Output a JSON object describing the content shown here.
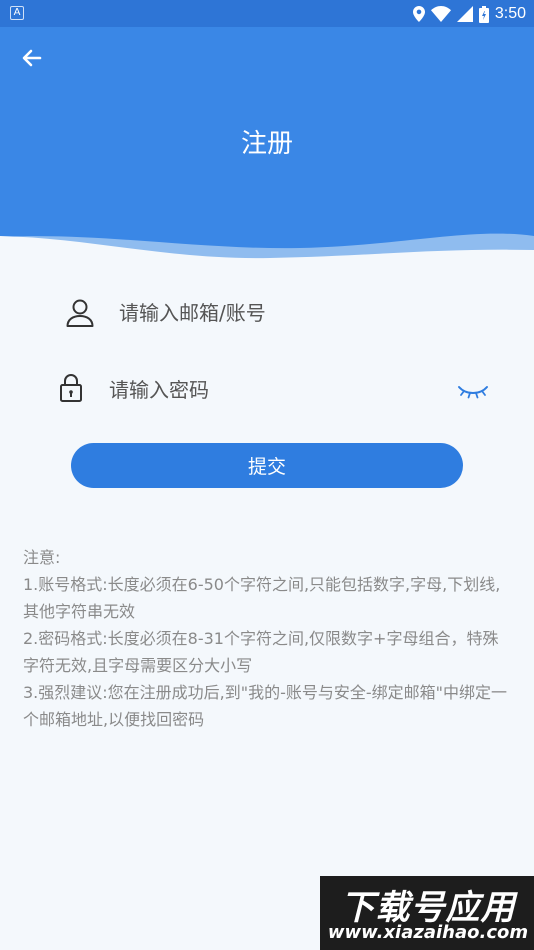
{
  "status_bar": {
    "app_icon_letter": "A",
    "time": "3:50"
  },
  "header": {
    "title": "注册"
  },
  "form": {
    "account_placeholder": "请输入邮箱/账号",
    "password_placeholder": "请输入密码",
    "submit_label": "提交"
  },
  "notes": {
    "heading": "注意:",
    "items": [
      "1.账号格式:长度必须在6-50个字符之间,只能包括数字,字母,下划线,其他字符串无效",
      "2.密码格式:长度必须在8-31个字符之间,仅限数字+字母组合，特殊字符无效,且字母需要区分大小写",
      "3.强烈建议:您在注册成功后,到\"我的-账号与安全-绑定邮箱\"中绑定一个邮箱地址,以便找回密码"
    ]
  },
  "watermark": {
    "title": "下载号应用",
    "url": "www.xiazaihao.com"
  },
  "colors": {
    "header_blue": "#3a87e6",
    "status_blue": "#2e75d6",
    "button_blue": "#2f7de0",
    "background": "#f4f8fc",
    "notes_gray": "#8a8a8a"
  }
}
